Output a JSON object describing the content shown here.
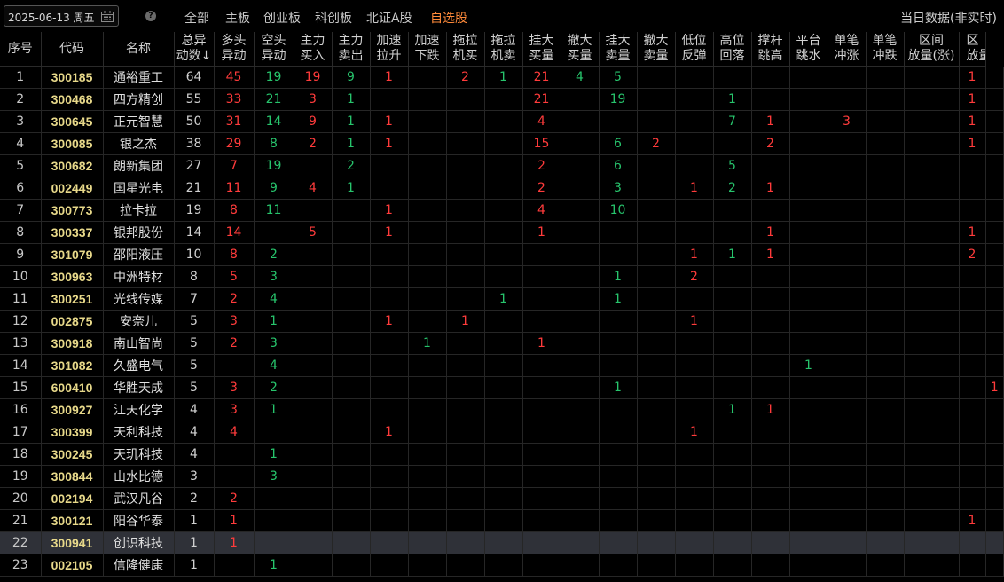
{
  "toolbar": {
    "date": "2025-06-13 周五",
    "tabs": [
      "全部",
      "主板",
      "创业板",
      "科创板",
      "北证A股",
      "自选股"
    ],
    "active_tab": 5,
    "realtime_label": "当日数据(非实时)"
  },
  "columns": [
    [
      "序号",
      ""
    ],
    [
      "代码",
      ""
    ],
    [
      "名称",
      ""
    ],
    [
      "总异",
      "动数↓"
    ],
    [
      "多头",
      "异动"
    ],
    [
      "空头",
      "异动"
    ],
    [
      "主力",
      "买入"
    ],
    [
      "主力",
      "卖出"
    ],
    [
      "加速",
      "拉升"
    ],
    [
      "加速",
      "下跌"
    ],
    [
      "拖拉",
      "机买"
    ],
    [
      "拖拉",
      "机卖"
    ],
    [
      "挂大",
      "买量"
    ],
    [
      "撤大",
      "买量"
    ],
    [
      "挂大",
      "卖量"
    ],
    [
      "撤大",
      "卖量"
    ],
    [
      "低位",
      "反弹"
    ],
    [
      "高位",
      "回落"
    ],
    [
      "撑杆",
      "跳高"
    ],
    [
      "平台",
      "跳水"
    ],
    [
      "单笔",
      "冲涨"
    ],
    [
      "单笔",
      "冲跌"
    ],
    [
      "区间",
      "放量(涨)"
    ],
    [
      "区",
      "放量"
    ]
  ],
  "colors": {
    "rise": "#ff3b3b",
    "fall": "#27c46c",
    "code": "#e8d98a",
    "selected_row": "#2f3138"
  },
  "selected_row": 21,
  "rows": [
    {
      "seq": "1",
      "code": "300185",
      "name": "通裕重工",
      "total": "64",
      "c": [
        "45",
        "19",
        "19",
        "9",
        "1",
        "",
        "2",
        "1",
        "21",
        "4",
        "5",
        "",
        "",
        "",
        "",
        "",
        "",
        "",
        "",
        "1",
        ""
      ]
    },
    {
      "seq": "2",
      "code": "300468",
      "name": "四方精创",
      "total": "55",
      "c": [
        "33",
        "21",
        "3",
        "1",
        "",
        "",
        "",
        "",
        "21",
        "",
        "19",
        "",
        "",
        "1",
        "",
        "",
        "",
        "",
        "",
        "1",
        ""
      ]
    },
    {
      "seq": "3",
      "code": "300645",
      "name": "正元智慧",
      "total": "50",
      "c": [
        "31",
        "14",
        "9",
        "1",
        "1",
        "",
        "",
        "",
        "4",
        "",
        "",
        "",
        "",
        "7",
        "1",
        "",
        "3",
        "",
        "",
        "1",
        ""
      ]
    },
    {
      "seq": "4",
      "code": "300085",
      "name": "银之杰",
      "total": "38",
      "c": [
        "29",
        "8",
        "2",
        "1",
        "1",
        "",
        "",
        "",
        "15",
        "",
        "6",
        "2",
        "",
        "",
        "2",
        "",
        "",
        "",
        "",
        "1",
        ""
      ]
    },
    {
      "seq": "5",
      "code": "300682",
      "name": "朗新集团",
      "total": "27",
      "c": [
        "7",
        "19",
        "",
        "2",
        "",
        "",
        "",
        "",
        "2",
        "",
        "6",
        "",
        "",
        "5",
        "",
        "",
        "",
        "",
        "",
        "",
        ""
      ]
    },
    {
      "seq": "6",
      "code": "002449",
      "name": "国星光电",
      "total": "21",
      "c": [
        "11",
        "9",
        "4",
        "1",
        "",
        "",
        "",
        "",
        "2",
        "",
        "3",
        "",
        "1",
        "2",
        "1",
        "",
        "",
        "",
        "",
        "",
        ""
      ]
    },
    {
      "seq": "7",
      "code": "300773",
      "name": "拉卡拉",
      "total": "19",
      "c": [
        "8",
        "11",
        "",
        "",
        "1",
        "",
        "",
        "",
        "4",
        "",
        "10",
        "",
        "",
        "",
        "",
        "",
        "",
        "",
        "",
        "",
        ""
      ]
    },
    {
      "seq": "8",
      "code": "300337",
      "name": "银邦股份",
      "total": "14",
      "c": [
        "14",
        "",
        "5",
        "",
        "1",
        "",
        "",
        "",
        "1",
        "",
        "",
        "",
        "",
        "",
        "1",
        "",
        "",
        "",
        "",
        "1",
        ""
      ]
    },
    {
      "seq": "9",
      "code": "301079",
      "name": "邵阳液压",
      "total": "10",
      "c": [
        "8",
        "2",
        "",
        "",
        "",
        "",
        "",
        "",
        "",
        "",
        "",
        "",
        "1",
        "1",
        "1",
        "",
        "",
        "",
        "",
        "2",
        ""
      ]
    },
    {
      "seq": "10",
      "code": "300963",
      "name": "中洲特材",
      "total": "8",
      "c": [
        "5",
        "3",
        "",
        "",
        "",
        "",
        "",
        "",
        "",
        "",
        "1",
        "",
        "2",
        "",
        "",
        "",
        "",
        "",
        "",
        "",
        ""
      ]
    },
    {
      "seq": "11",
      "code": "300251",
      "name": "光线传媒",
      "total": "7",
      "c": [
        "2",
        "4",
        "",
        "",
        "",
        "",
        "",
        "1",
        "",
        "",
        "1",
        "",
        "",
        "",
        "",
        "",
        "",
        "",
        "",
        "",
        ""
      ]
    },
    {
      "seq": "12",
      "code": "002875",
      "name": "安奈儿",
      "total": "5",
      "c": [
        "3",
        "1",
        "",
        "",
        "1",
        "",
        "1",
        "",
        "",
        "",
        "",
        "",
        "1",
        "",
        "",
        "",
        "",
        "",
        "",
        "",
        ""
      ]
    },
    {
      "seq": "13",
      "code": "300918",
      "name": "南山智尚",
      "total": "5",
      "c": [
        "2",
        "3",
        "",
        "",
        "",
        "1",
        "",
        "",
        "1",
        "",
        "",
        "",
        "",
        "",
        "",
        "",
        "",
        "",
        "",
        "",
        ""
      ]
    },
    {
      "seq": "14",
      "code": "301082",
      "name": "久盛电气",
      "total": "5",
      "c": [
        "",
        "4",
        "",
        "",
        "",
        "",
        "",
        "",
        "",
        "",
        "",
        "",
        "",
        "",
        "",
        "1",
        "",
        "",
        "",
        "",
        ""
      ]
    },
    {
      "seq": "15",
      "code": "600410",
      "name": "华胜天成",
      "total": "5",
      "c": [
        "3",
        "2",
        "",
        "",
        "",
        "",
        "",
        "",
        "",
        "",
        "1",
        "",
        "",
        "",
        "",
        "",
        "",
        "",
        "",
        "",
        "1"
      ]
    },
    {
      "seq": "16",
      "code": "300927",
      "name": "江天化学",
      "total": "4",
      "c": [
        "3",
        "1",
        "",
        "",
        "",
        "",
        "",
        "",
        "",
        "",
        "",
        "",
        "",
        "1",
        "1",
        "",
        "",
        "",
        "",
        "",
        ""
      ]
    },
    {
      "seq": "17",
      "code": "300399",
      "name": "天利科技",
      "total": "4",
      "c": [
        "4",
        "",
        "",
        "",
        "1",
        "",
        "",
        "",
        "",
        "",
        "",
        "",
        "1",
        "",
        "",
        "",
        "",
        "",
        "",
        "",
        ""
      ]
    },
    {
      "seq": "18",
      "code": "300245",
      "name": "天玑科技",
      "total": "4",
      "c": [
        "",
        "1",
        "",
        "",
        "",
        "",
        "",
        "",
        "",
        "",
        "",
        "",
        "",
        "",
        "",
        "",
        "",
        "",
        "",
        "",
        ""
      ]
    },
    {
      "seq": "19",
      "code": "300844",
      "name": "山水比德",
      "total": "3",
      "c": [
        "",
        "3",
        "",
        "",
        "",
        "",
        "",
        "",
        "",
        "",
        "",
        "",
        "",
        "",
        "",
        "",
        "",
        "",
        "",
        "",
        ""
      ]
    },
    {
      "seq": "20",
      "code": "002194",
      "name": "武汉凡谷",
      "total": "2",
      "c": [
        "2",
        "",
        "",
        "",
        "",
        "",
        "",
        "",
        "",
        "",
        "",
        "",
        "",
        "",
        "",
        "",
        "",
        "",
        "",
        "",
        ""
      ]
    },
    {
      "seq": "21",
      "code": "300121",
      "name": "阳谷华泰",
      "total": "1",
      "c": [
        "1",
        "",
        "",
        "",
        "",
        "",
        "",
        "",
        "",
        "",
        "",
        "",
        "",
        "",
        "",
        "",
        "",
        "",
        "",
        "1",
        ""
      ]
    },
    {
      "seq": "22",
      "code": "300941",
      "name": "创识科技",
      "total": "1",
      "c": [
        "1",
        "",
        "",
        "",
        "",
        "",
        "",
        "",
        "",
        "",
        "",
        "",
        "",
        "",
        "",
        "",
        "",
        "",
        "",
        "",
        ""
      ]
    },
    {
      "seq": "23",
      "code": "002105",
      "name": "信隆健康",
      "total": "1",
      "c": [
        "",
        "1",
        "",
        "",
        "",
        "",
        "",
        "",
        "",
        "",
        "",
        "",
        "",
        "",
        "",
        "",
        "",
        "",
        "",
        "",
        ""
      ]
    }
  ]
}
